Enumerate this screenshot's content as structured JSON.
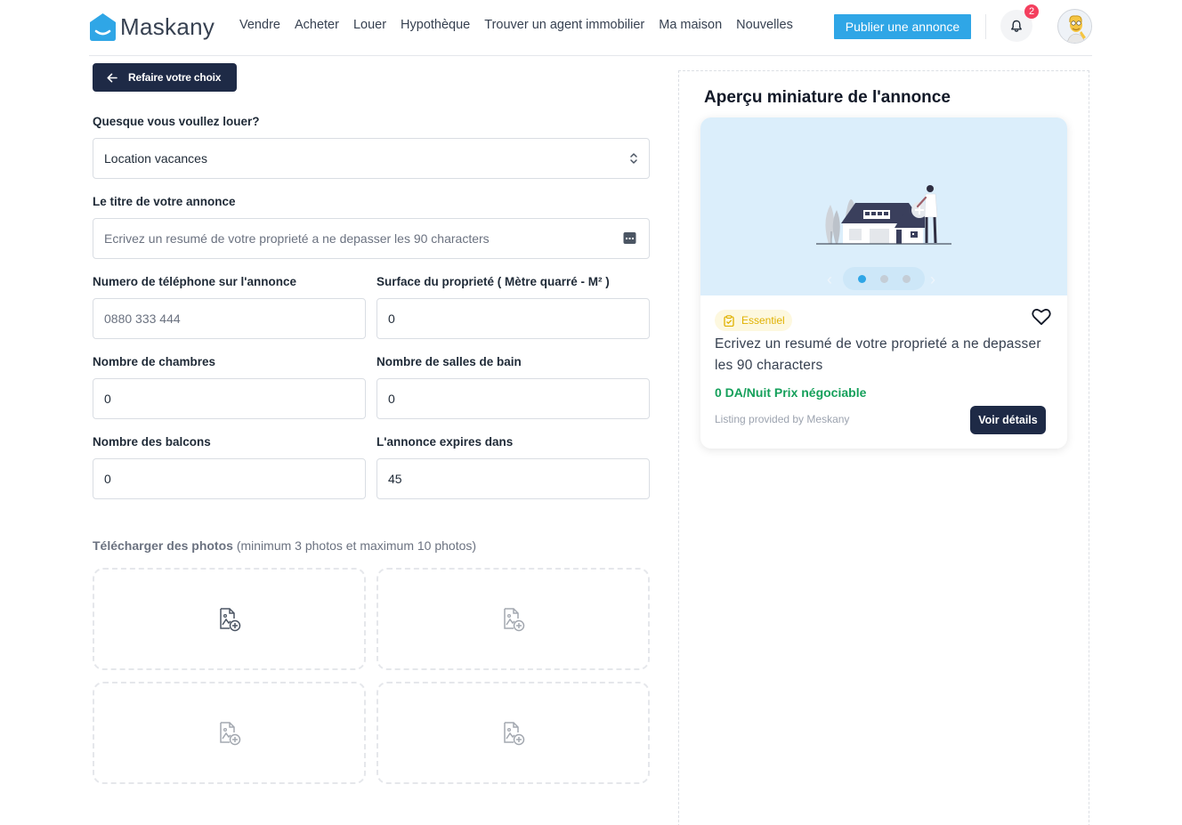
{
  "header": {
    "logo_text": "Maskany",
    "nav": [
      "Vendre",
      "Acheter",
      "Louer",
      "Hypothèque",
      "Trouver un agent immobilier",
      "Ma maison",
      "Nouvelles"
    ],
    "publish_label": "Publier une annonce",
    "notification_count": "2"
  },
  "form": {
    "back_label": "Refaire votre choix",
    "rent_type": {
      "label": "Quesque vous voullez louer?",
      "value": "Location vacances"
    },
    "title": {
      "label": "Le titre de votre annonce",
      "placeholder": "Ecrivez un resumé de votre proprieté a ne depasser les 90 characters"
    },
    "phone": {
      "label": "Numero de téléphone sur l'annonce",
      "placeholder": "0880 333 444"
    },
    "surface": {
      "label": "Surface du proprieté ( Mètre quarré - M² )",
      "value": "0"
    },
    "bedrooms": {
      "label": "Nombre de chambres",
      "value": "0"
    },
    "bathrooms": {
      "label": "Nombre de salles de bain",
      "value": "0"
    },
    "balconies": {
      "label": "Nombre des balcons",
      "value": "0"
    },
    "expires": {
      "label": "L'annonce expires dans",
      "value": "45"
    },
    "upload": {
      "label": "Télécharger des photos",
      "hint": "(minimum 3 photos et maximum 10 photos)"
    }
  },
  "preview": {
    "title": "Aperçu miniature de l'annonce",
    "tag": "Essentiel",
    "card_title": "Ecrivez un resumé de votre proprieté a ne depasser les 90 characters",
    "price": "0 DA/Nuit Prix négociable",
    "provider": "Listing provided by Meskany",
    "details_label": "Voir détails",
    "slide_count": 3,
    "active_slide": 1
  },
  "colors": {
    "brand_blue": "#2fa6e6",
    "navy": "#1e2a46",
    "price_green": "#15a05b",
    "tag_yellow": "#e0b100",
    "badge_red": "#f43f5e"
  },
  "icons": [
    "logo-house-icon",
    "bell-icon",
    "arrow-left-icon",
    "select-arrows-icon",
    "keyboard-icon",
    "image-add-icon",
    "clipboard-check-icon",
    "heart-icon",
    "chevron-left-icon",
    "chevron-right-icon"
  ]
}
